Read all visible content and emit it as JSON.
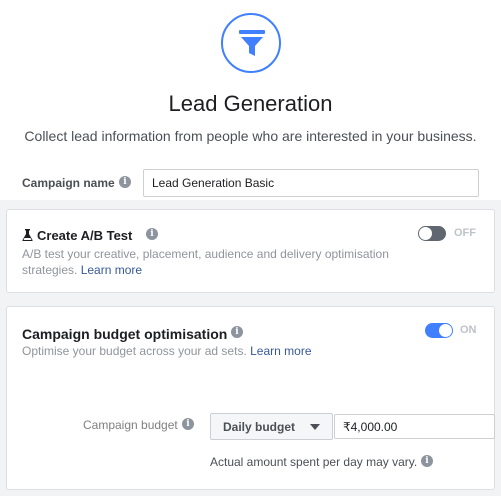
{
  "header": {
    "icon": "funnel-icon",
    "title": "Lead Generation",
    "subtitle": "Collect lead information from people who are interested in your business."
  },
  "campaign_name": {
    "label": "Campaign name",
    "value": "Lead Generation Basic"
  },
  "ab_test": {
    "title": "Create A/B Test",
    "description": "A/B test your creative, placement, audience and delivery optimisation strategies.",
    "link": "Learn more",
    "toggle_label": "OFF",
    "enabled": false
  },
  "cbo": {
    "title": "Campaign budget optimisation",
    "description": "Optimise your budget across your ad sets.",
    "link": "Learn more",
    "toggle_label": "ON",
    "enabled": true,
    "budget_label": "Campaign budget",
    "budget_type": "Daily budget",
    "budget_value": "₹4,000.00",
    "note": "Actual amount spent per day may vary."
  },
  "colors": {
    "accent": "#4080ff",
    "link": "#365899",
    "toggle_off": "#606770"
  }
}
